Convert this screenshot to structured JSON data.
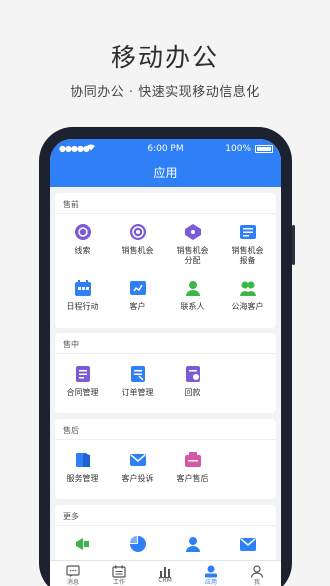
{
  "hero": {
    "title": "移动办公",
    "subtitle": "协同办公 · 快速实现移动信息化"
  },
  "status_bar": {
    "signal": "●●●●●",
    "time": "6:00 PM",
    "battery": "100%"
  },
  "nav": {
    "title": "应用"
  },
  "sections": [
    {
      "title": "售前",
      "items": [
        {
          "label": "线索",
          "icon": "lead-icon"
        },
        {
          "label": "销售机会",
          "icon": "target-icon"
        },
        {
          "label": "销售机会\n分配",
          "icon": "tag-icon"
        },
        {
          "label": "销售机会\n报备",
          "icon": "report-icon"
        },
        {
          "label": "日程行动",
          "icon": "calendar-icon"
        },
        {
          "label": "客户",
          "icon": "customer-icon"
        },
        {
          "label": "联系人",
          "icon": "contacts-icon"
        },
        {
          "label": "公海客户",
          "icon": "public-customer-icon"
        }
      ]
    },
    {
      "title": "售中",
      "items": [
        {
          "label": "合同管理",
          "icon": "contract-icon"
        },
        {
          "label": "订单管理",
          "icon": "order-icon"
        },
        {
          "label": "回款",
          "icon": "payment-icon"
        }
      ]
    },
    {
      "title": "售后",
      "items": [
        {
          "label": "服务管理",
          "icon": "service-icon"
        },
        {
          "label": "客户投诉",
          "icon": "complaint-icon"
        },
        {
          "label": "客户售后",
          "icon": "after-sales-icon"
        }
      ]
    },
    {
      "title": "更多",
      "items": []
    }
  ],
  "tabs": [
    {
      "label": "消息",
      "icon": "message-icon"
    },
    {
      "label": "工作",
      "icon": "work-icon"
    },
    {
      "label": "CRM",
      "icon": "crm-icon"
    },
    {
      "label": "应用",
      "icon": "apps-icon",
      "active": true
    },
    {
      "label": "我",
      "icon": "profile-icon"
    }
  ],
  "colors": {
    "primary": "#2f7ff6",
    "purple": "#7b5cd6",
    "green": "#3cb54a",
    "orange": "#f2a531"
  }
}
